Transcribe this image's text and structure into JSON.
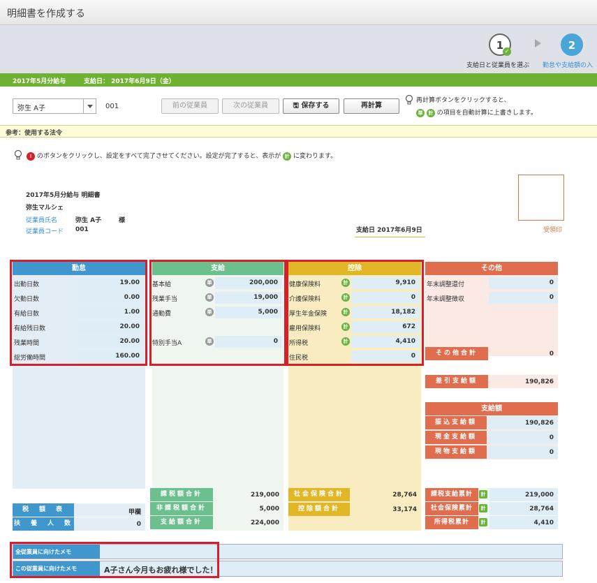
{
  "window": {
    "title": "明細書を作成する"
  },
  "steps": {
    "step1": {
      "num": "1",
      "label": "支給日と従業員を選ぶ"
    },
    "step2": {
      "num": "2",
      "label": "勤怠や支給額の入"
    }
  },
  "payinfo": {
    "period": "2017年5月分給与",
    "payday": "支給日： 2017年6月9日（金）"
  },
  "toolbar": {
    "employee": "弥生 A子",
    "employee_code": "001",
    "prev": "前の従業員",
    "next": "次の従業員",
    "save": "保存する",
    "recalc": "再計算",
    "hint1": "再計算ボタンをクリックすると、",
    "hint2": "の項目を自動計算に上書きします。",
    "badge_tan": "単",
    "badge_kei": "計"
  },
  "ref": {
    "label": "参考：使用する法令"
  },
  "notice": {
    "pre": "のボタンをクリックし、設定をすべて完了させてください。設定が完了すると、表示が",
    "post": "に変わります。",
    "badge_alert": "!",
    "badge_ok": "計"
  },
  "doc": {
    "title": "2017年5月分給与 明細書",
    "company": "弥生マルシェ",
    "name_label": "従業員氏名",
    "name": "弥生 A子",
    "honorific": "様",
    "code_label": "従業員コード",
    "code": "001",
    "payday": "支給日 2017年6月9日",
    "stamp_label": "受領印"
  },
  "kintai": {
    "header": "勤怠",
    "rows": [
      {
        "label": "出勤日数",
        "value": "19.00"
      },
      {
        "label": "欠勤日数",
        "value": "0.00"
      },
      {
        "label": "有給日数",
        "value": "1.00"
      },
      {
        "label": "有給残日数",
        "value": "20.00"
      },
      {
        "label": "残業時間",
        "value": "20.00"
      },
      {
        "label": "総労働時間",
        "value": "160.00"
      }
    ],
    "tax_table_label": "税　額　表",
    "tax_table_value": "甲欄",
    "dependents_label": "扶　養　人　数",
    "dependents_value": "0"
  },
  "shikyu": {
    "header": "支給",
    "rows": [
      {
        "label": "基本給",
        "badge": "単",
        "value": "200,000"
      },
      {
        "label": "残業手当",
        "badge": "単",
        "value": "19,000"
      },
      {
        "label": "通勤費",
        "badge": "単",
        "value": "5,000"
      },
      {
        "label": "",
        "badge": "",
        "value": ""
      },
      {
        "label": "特別手当A",
        "badge": "単",
        "value": "0"
      }
    ],
    "sums": [
      {
        "label": "課税額合計",
        "value": "219,000"
      },
      {
        "label": "非課税額合計",
        "value": "5,000"
      },
      {
        "label": "支給額合計",
        "value": "224,000"
      }
    ]
  },
  "kojo": {
    "header": "控除",
    "rows": [
      {
        "label": "健康保険料",
        "badge": "計",
        "value": "9,910"
      },
      {
        "label": "介護保険料",
        "badge": "計",
        "value": "0"
      },
      {
        "label": "厚生年金保険",
        "badge": "計",
        "value": "18,182"
      },
      {
        "label": "雇用保険料",
        "badge": "計",
        "value": "672"
      },
      {
        "label": "所得税",
        "badge": "計",
        "value": "4,410"
      },
      {
        "label": "住民税",
        "badge": "",
        "value": "0"
      }
    ],
    "sums": [
      {
        "label": "社会保険合計",
        "value": "28,764"
      },
      {
        "label": "控除額合計",
        "value": "33,174"
      }
    ]
  },
  "sonota": {
    "header": "その他",
    "rows": [
      {
        "label": "年末調整還付",
        "value": "0"
      },
      {
        "label": "年末調整徴収",
        "value": "0"
      }
    ],
    "total_label": "その他合計",
    "total_value": "0",
    "net_label": "差引支給額",
    "net_value": "190,826",
    "payment_header": "支給額",
    "payments": [
      {
        "label": "振込支給額",
        "value": "190,826"
      },
      {
        "label": "現金支給額",
        "value": "0"
      },
      {
        "label": "現物支給額",
        "value": "0"
      }
    ],
    "cumulative": [
      {
        "label": "課税支給累計",
        "badge": "計",
        "value": "219,000"
      },
      {
        "label": "社会保険累計",
        "badge": "計",
        "value": "28,764"
      },
      {
        "label": "所得税累計",
        "badge": "計",
        "value": "4,410"
      }
    ]
  },
  "memo": {
    "all_label": "全従業員に向けたメモ",
    "all_value": "",
    "this_label": "この従業員に向けたメモ",
    "this_value": "A子さん今月もお疲れ様でした！"
  },
  "colors": {
    "kintai": "#3f97cd",
    "shikyu": "#6cc08d",
    "kojo": "#e2b727",
    "sonota": "#e06d4d",
    "alert": "#d71f2a",
    "brand_green": "#6fb131"
  }
}
